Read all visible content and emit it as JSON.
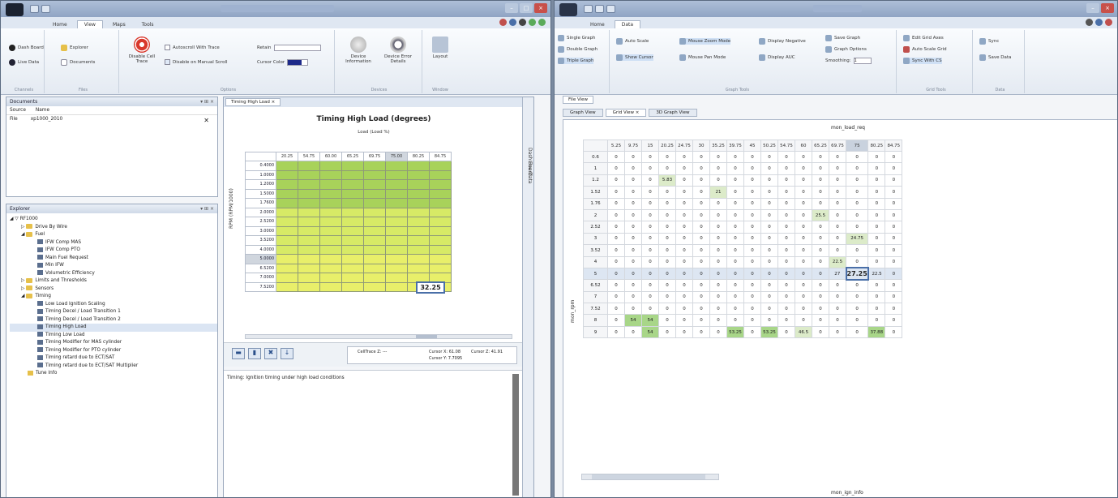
{
  "left": {
    "title": "",
    "tabs": [
      "Home",
      "View",
      "Maps",
      "Tools"
    ],
    "ribbon": {
      "channels": {
        "label": "Channels",
        "items": [
          "Dash Board",
          "Live Data"
        ]
      },
      "files": {
        "label": "Files",
        "items": [
          "Explorer",
          "Documents"
        ]
      },
      "options": {
        "label": "Options",
        "big": "Disable Cell Trace",
        "checks": [
          "Autoscroll With Trace",
          "Disable on Manual Scroll"
        ],
        "retain": "Retain",
        "cursor": "Cursor Color"
      },
      "devices": {
        "label": "Devices",
        "items": [
          "Device Information",
          "Device Error Details"
        ]
      },
      "window": {
        "label": "Window",
        "item": "Layout"
      }
    },
    "documents": {
      "title": "Documents",
      "col1": "Source",
      "col2": "Name",
      "row_src": "File",
      "row_name": "xp1000_2010"
    },
    "explorer": {
      "title": "Explorer",
      "items": [
        "RF1000",
        "Drive By Wire",
        "Fuel",
        "IFW Comp MAS",
        "IFW Comp PTO",
        "Main Fuel Request",
        "Min IFW",
        "Volumetric Efficiency",
        "Limits and Thresholds",
        "Sensors",
        "Timing",
        "Low Load Ignition Scaling",
        "Timing Decel / Load Transition 1",
        "Timing Decel / Load Transition 2",
        "Timing High Load",
        "Timing Low Load",
        "Timing Modifier for MAS cylinder",
        "Timing Modifier for PTO cylinder",
        "Timing retard due to ECT/SAT",
        "Timing retard due to ECT/SAT Multiplier",
        "Tune Info"
      ]
    },
    "map": {
      "tab": "Timing High Load",
      "title": "Timing High Load (degrees)",
      "xlabel": "Load (Load %)",
      "ylabel": "RPM (RPM/1000)",
      "cols": [
        "20.25",
        "54.75",
        "60.00",
        "65.25",
        "69.75",
        "75.00",
        "80.25",
        "84.75"
      ],
      "rows": [
        "0.4000",
        "1.0000",
        "1.2000",
        "1.5000",
        "1.7600",
        "2.0000",
        "2.5200",
        "3.0000",
        "3.5200",
        "4.0000",
        "5.0000",
        "6.5200",
        "7.0000",
        "7.5200"
      ],
      "cursor_value": "32.25",
      "status_celltrace": "CellTrace Z: ---",
      "status_cx": "Cursor X: 61.08",
      "status_cz": "Cursor Z: 41.91",
      "status_cy": "Cursor Y: 7.7095",
      "description": "Timing: Ignition timing under high load conditions"
    },
    "side_tabs": [
      "Dash Board",
      "Live Data"
    ]
  },
  "right": {
    "title": "",
    "tabs": [
      "Home",
      "Data"
    ],
    "ribbon": {
      "graph": [
        "Single Graph",
        "Double Graph",
        "Triple Graph"
      ],
      "g2": [
        "Auto Scale",
        "Show Cursor"
      ],
      "g3": [
        "Mouse Zoom Mode",
        "Mouse Pan Mode"
      ],
      "g4": [
        "Display Negative",
        "Display AUC"
      ],
      "g5": [
        "Save Graph",
        "Graph Options",
        "Smoothing:"
      ],
      "smooth_val": "1",
      "grid": [
        "Edit Grid Axes",
        "Auto Scale Grid",
        "Sync With CS"
      ],
      "data": [
        "Sync",
        "Save Data"
      ],
      "graph_tools": "Graph Tools",
      "grid_tools": "Grid Tools",
      "data_label": "Data"
    },
    "file_tab": "File View",
    "view_tabs": [
      "Graph View",
      "Grid View",
      "3D Graph View"
    ],
    "grid": {
      "xlabel": "mon_load_req",
      "ylabel": "mon_rpm",
      "bottom_label": "mon_ign_info",
      "cols": [
        "5.25",
        "9.75",
        "15",
        "20.25",
        "24.75",
        "30",
        "35.25",
        "39.75",
        "45",
        "50.25",
        "54.75",
        "60",
        "65.25",
        "69.75",
        "75",
        "80.25",
        "84.75"
      ],
      "rows": [
        "0.6",
        "1",
        "1.2",
        "1.52",
        "1.76",
        "2",
        "2.52",
        "3",
        "3.52",
        "4",
        "5",
        "6.52",
        "7",
        "7.52",
        "8",
        "9"
      ],
      "special": {
        "1.2_20.25": "5.83",
        "1.52_35.25": "21",
        "2_65.25": "25.5",
        "3_75": "24.75",
        "4_69.75": "22.5",
        "5_69.75": "27",
        "5_75": "27.25",
        "5_80.25": "22.5",
        "8_9.75": "54",
        "8_15": "54",
        "9_15": "54",
        "9_39.75": "53.25",
        "9_50.25": "53.25",
        "9_60": "46.5",
        "9_80.25": "37.88"
      }
    }
  }
}
